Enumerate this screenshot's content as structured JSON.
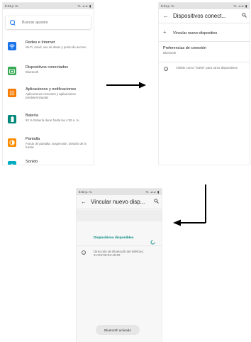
{
  "screen1": {
    "time": "5:31 p. m.",
    "status_icons": "% ⊿⊿ ▮",
    "search_placeholder": "Buscar ajustes",
    "items": [
      {
        "title": "Redes e Internet",
        "subtitle": "Wi-Fi, móvil, uso de datos y punto de acceso",
        "icon": "wifi-icon",
        "glyph": "📶",
        "color": "#1a73e8"
      },
      {
        "title": "Dispositivos conectados",
        "subtitle": "Bluetooth",
        "icon": "connected-devices-icon",
        "glyph": "▭",
        "color": "#34a853"
      },
      {
        "title": "Aplicaciones y notificaciones",
        "subtitle": "Aplicaciones recientes y aplicaciones predeterminadas",
        "icon": "apps-icon",
        "glyph": "⁞⁞",
        "color": "#f57c00"
      },
      {
        "title": "Batería",
        "subtitle": "63 % Debería durar hasta las 4:30 a. m.",
        "icon": "battery-icon",
        "glyph": "▮",
        "color": "#00897b"
      },
      {
        "title": "Pantalla",
        "subtitle": "Fondo de pantalla, suspensión, tamaño de la fuente",
        "icon": "display-icon",
        "glyph": "☼",
        "color": "#fb8c00"
      },
      {
        "title": "Sonido",
        "subtitle": "",
        "icon": "sound-icon",
        "glyph": "♪",
        "color": "#00acc1"
      }
    ]
  },
  "screen2": {
    "time": "5:31 p. m.",
    "status_icons": "% ⊿⊿ ▮",
    "title": "Dispositivos conect...",
    "pair_label": "Vincular nuevo dispositivo",
    "prefs_title": "Preferencias de conexión",
    "prefs_sub": "Bluetooth",
    "visible_text": "Visible como \"G550\" para otros dispositivos"
  },
  "screen3": {
    "time": "5:32 p. m.",
    "status_icons": "% ⊿⊿ ▮",
    "title": "Vincular nuevo disp...",
    "available_label": "Dispositivos disponibles",
    "address_text": "Dirección de Bluetooth del teléfono: 21:D3:09:E2:40:82",
    "toast": "Bluetooth activado"
  },
  "colors": {
    "accent": "#1a73e8",
    "teal": "#00897b",
    "arrow": "#000000"
  }
}
